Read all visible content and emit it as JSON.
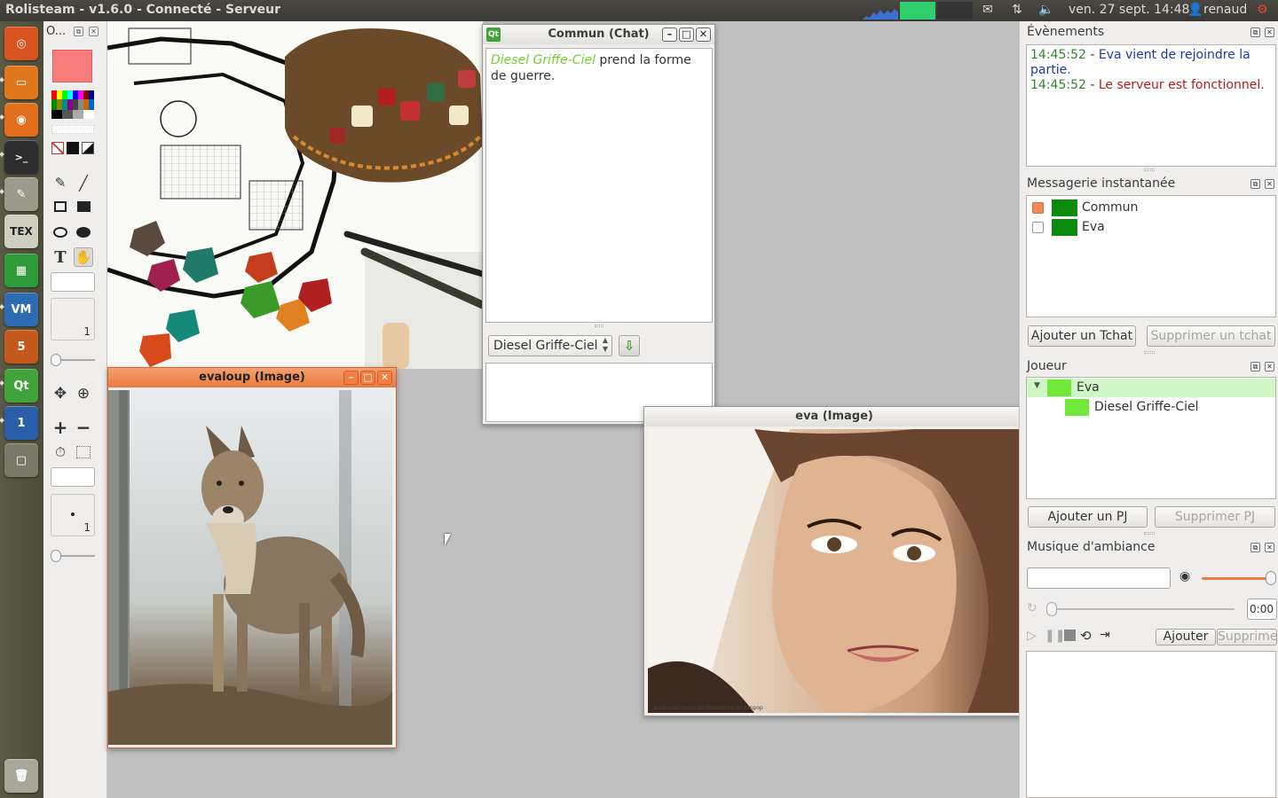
{
  "topbar": {
    "title": "Rolisteam - v1.6.0 - Connecté - Serveur",
    "datetime": "ven. 27 sept. 14:48",
    "user": "renaud"
  },
  "launcher": {
    "items": [
      {
        "name": "ubuntu-home-icon",
        "color": "#d9531e",
        "glyph": "◎"
      },
      {
        "name": "files-icon",
        "color": "#e0771c",
        "glyph": "▭"
      },
      {
        "name": "firefox-icon",
        "color": "#e36f1c",
        "glyph": "◉"
      },
      {
        "name": "terminal-icon",
        "color": "#2d2d2d",
        "glyph": ">_"
      },
      {
        "name": "text-editor-icon",
        "color": "#9b9b8c",
        "glyph": "✎"
      },
      {
        "name": "tex-icon",
        "color": "#cfcfc0",
        "glyph": "TEX"
      },
      {
        "name": "spreadsheet-icon",
        "color": "#2f9a3a",
        "glyph": "▦"
      },
      {
        "name": "virtualbox-icon",
        "color": "#2d6bb2",
        "glyph": "VM"
      },
      {
        "name": "updates-icon",
        "color": "#c35a1c",
        "glyph": "5"
      },
      {
        "name": "qt-creator-icon",
        "color": "#41a43a",
        "glyph": "Qt"
      },
      {
        "name": "rolisteam-icon",
        "color": "#2a5ea8",
        "glyph": "1"
      },
      {
        "name": "workspace-switcher-icon",
        "color": "#7a7868",
        "glyph": "▢"
      }
    ],
    "trash": "trash-icon"
  },
  "toolpanel": {
    "title": "O...",
    "pen_size": "1",
    "npc_size": "1",
    "current_color": "#f87b7b"
  },
  "chat_window": {
    "title": "Commun (Chat)",
    "message_author": "Diesel Griffe-Ciel",
    "message_text": " prend la forme de guerre.",
    "author_color": "#6fd12a",
    "identity_select": "Diesel Griffe-Ciel"
  },
  "wolf_window": {
    "title": "evaloup (Image)"
  },
  "eva_window": {
    "title": "eva (Image)",
    "credit": "wallpaper made by flowerdrop on fanpop"
  },
  "events": {
    "title": "Évènements",
    "lines": [
      {
        "time": "14:45:52",
        "text": "Eva vient de rejoindre la partie.",
        "color": "#1a3aa8"
      },
      {
        "time": "14:45:52",
        "text": "Le serveur est fonctionnel.",
        "color": "#b51a1a"
      }
    ]
  },
  "messaging": {
    "title": "Messagerie instantanée",
    "items": [
      {
        "label": "Commun",
        "checked": true
      },
      {
        "label": "Eva",
        "checked": false
      }
    ],
    "add_button": "Ajouter un Tchat",
    "remove_button": "Supprimer un tchat"
  },
  "players": {
    "title": "Joueur",
    "player": "Eva",
    "character": "Diesel Griffe-Ciel",
    "add_button": "Ajouter un PJ",
    "remove_button": "Supprimer PJ"
  },
  "music": {
    "title": "Musique d'ambiance",
    "time": "0:00",
    "add_button": "Ajouter",
    "remove_button": "Supprimer"
  }
}
